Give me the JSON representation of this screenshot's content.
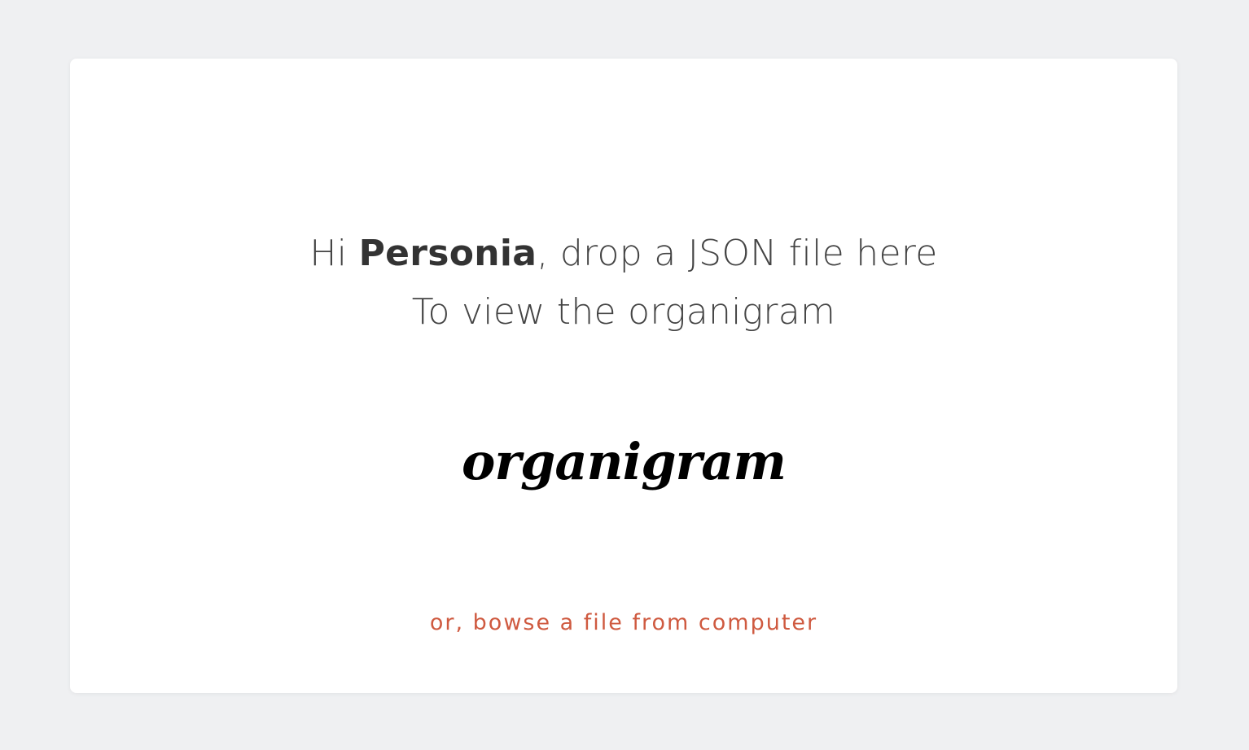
{
  "dropzone": {
    "greeting_prefix": "Hi ",
    "user_name": "Personia",
    "greeting_suffix": ", drop a JSON file here",
    "subtitle": "To view the organigram",
    "logo_text": "organigram",
    "browse_link": "or, bowse a file from computer"
  },
  "colors": {
    "background": "#eff0f2",
    "card": "#ffffff",
    "text": "#444444",
    "link": "#cf5a40"
  }
}
